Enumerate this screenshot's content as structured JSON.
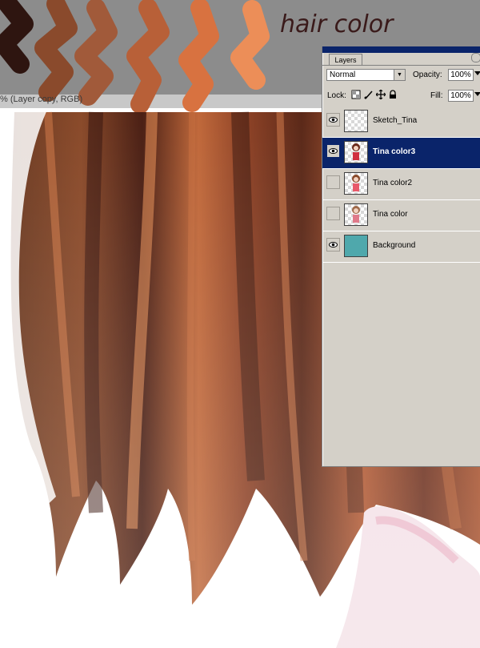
{
  "canvas": {
    "doc_title": "% (Layer copy, RGB)",
    "annotation": "hair color",
    "swatch_colors": [
      "#2e1510",
      "#8a4a2c",
      "#a15a3a",
      "#b86038",
      "#d87240",
      "#ec8e58"
    ]
  },
  "layers_panel": {
    "tab_label": "Layers",
    "blend_mode": "Normal",
    "opacity_label": "Opacity:",
    "opacity_value": "100%",
    "lock_label": "Lock:",
    "fill_label": "Fill:",
    "fill_value": "100%",
    "layers": [
      {
        "name": "Sketch_Tina",
        "visible": true,
        "selected": false,
        "thumb": "transparent-icon"
      },
      {
        "name": "Tina color3",
        "visible": true,
        "selected": true,
        "thumb": "figure-icon"
      },
      {
        "name": "Tina color2",
        "visible": false,
        "selected": false,
        "thumb": "figure-icon"
      },
      {
        "name": "Tina color",
        "visible": false,
        "selected": false,
        "thumb": "figure-icon"
      },
      {
        "name": "Background",
        "visible": true,
        "selected": false,
        "thumb": "solid-teal"
      }
    ]
  },
  "colors": {
    "panel_bg": "#d4d0c8",
    "selection": "#0a246a",
    "canvas_gray": "#8c8c8c"
  }
}
